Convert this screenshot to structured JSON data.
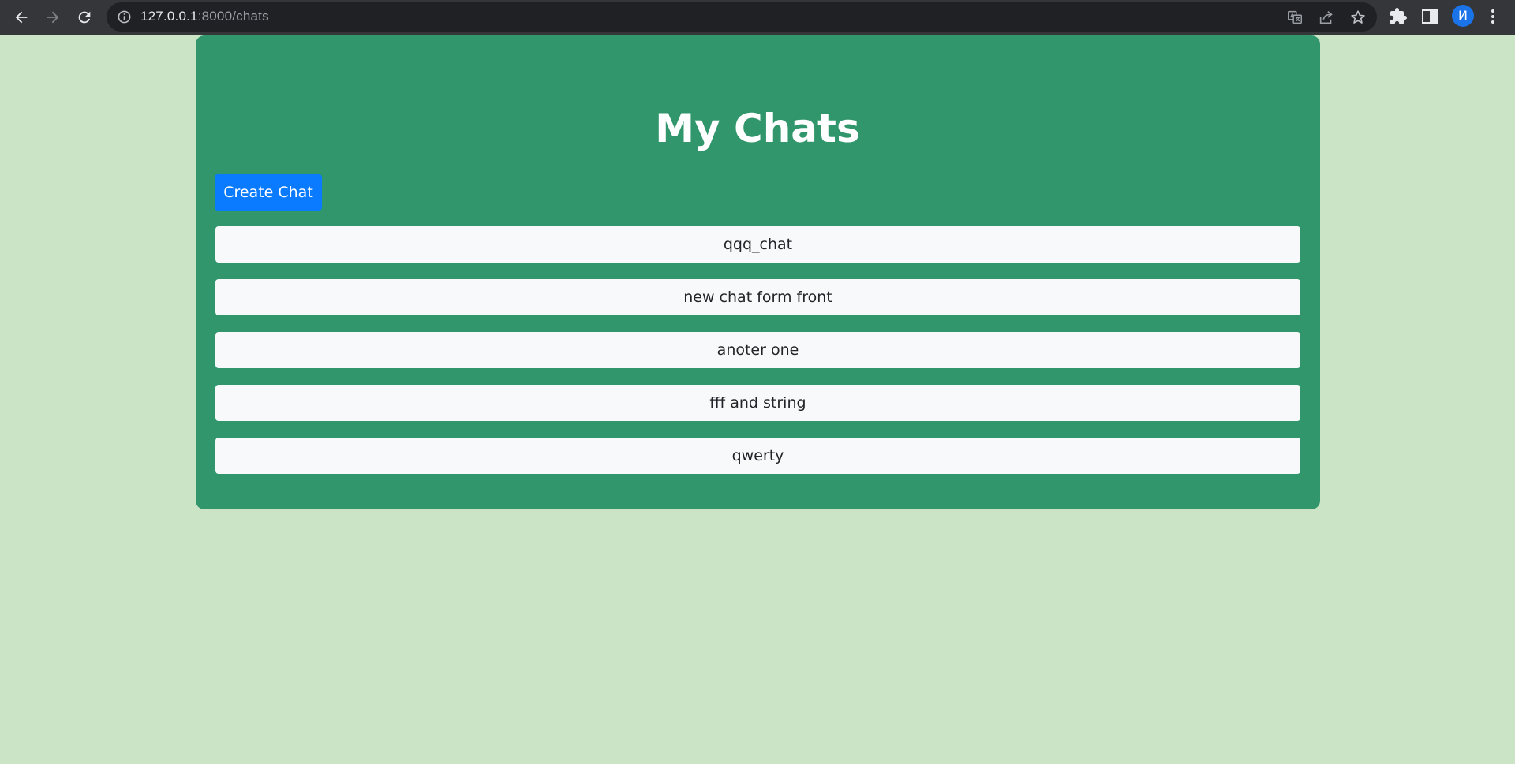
{
  "browser": {
    "url_host": "127.0.0.1",
    "url_path": ":8000/chats",
    "profile_initial": "И"
  },
  "page": {
    "title": "My Chats",
    "create_button_label": "Create Chat"
  },
  "chats": [
    "qqq_chat",
    "new chat form front",
    "anoter one",
    "fff and string",
    "qwerty"
  ],
  "colors": {
    "background": "#cbe4c6",
    "panel": "#31966b",
    "primary_button": "#0a7bff",
    "list_item": "#f8f9fa"
  }
}
